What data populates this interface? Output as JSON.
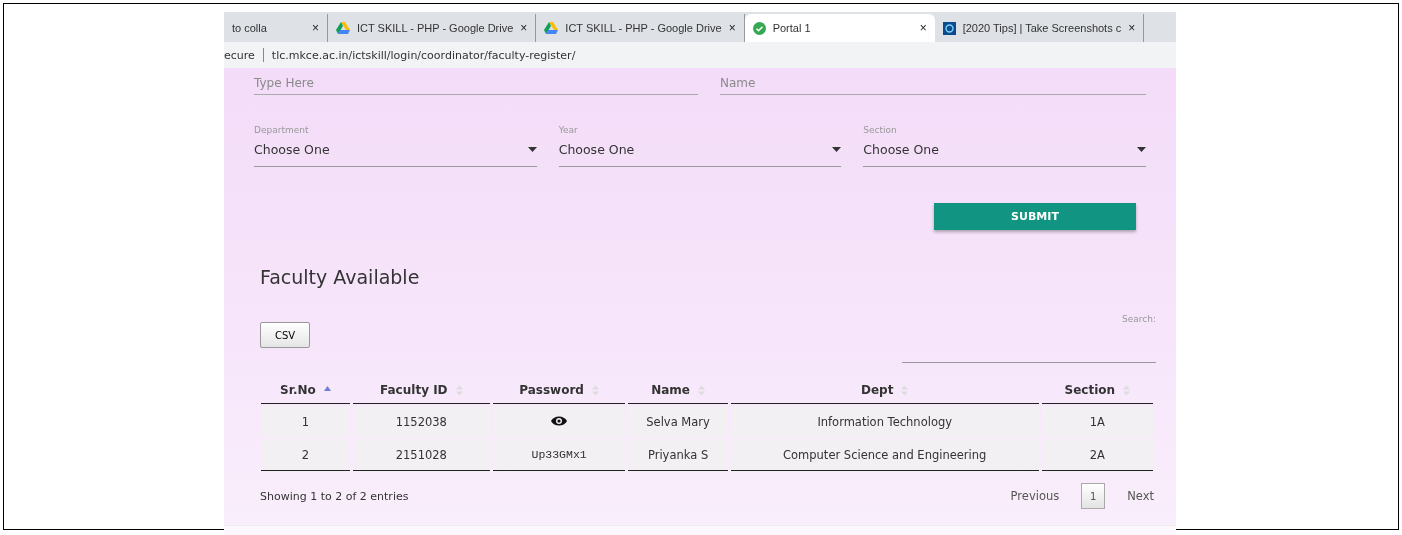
{
  "browser": {
    "tabs": [
      {
        "title": "to colla",
        "kind": "plain",
        "selected": false
      },
      {
        "title": "ICT SKILL - PHP - Google Drive",
        "kind": "drive",
        "selected": false
      },
      {
        "title": "ICT SKILL - PHP - Google Drive",
        "kind": "drive",
        "selected": false
      },
      {
        "title": "Portal 1",
        "kind": "check",
        "selected": true
      },
      {
        "title": "[2020 Tips] | Take Screenshots c",
        "kind": "site",
        "selected": false
      }
    ],
    "close_glyph": "×",
    "security": "ecure",
    "url": "tlc.mkce.ac.in/ictskill/login/coordinator/faculty-register/"
  },
  "form": {
    "top_fields": [
      {
        "placeholder": "Type Here"
      },
      {
        "placeholder": "Name"
      }
    ],
    "selects": [
      {
        "label": "Department",
        "value": "Choose One"
      },
      {
        "label": "Year",
        "value": "Choose One"
      },
      {
        "label": "Section",
        "value": "Choose One"
      }
    ],
    "submit": "SUBMIT"
  },
  "faculty": {
    "title": "Faculty Available",
    "csv": "CSV",
    "search_label": "Search:",
    "columns": [
      {
        "label": "Sr.No",
        "sorted": true
      },
      {
        "label": "Faculty ID",
        "sorted": false
      },
      {
        "label": "Password",
        "sorted": false
      },
      {
        "label": "Name",
        "sorted": false
      },
      {
        "label": "Dept",
        "sorted": false
      },
      {
        "label": "Section",
        "sorted": false
      }
    ],
    "rows": [
      {
        "sr": "1",
        "id": "1152038",
        "password_visible": false,
        "name": "Selva Mary",
        "dept": "Information Technology",
        "section": "1A"
      },
      {
        "sr": "2",
        "id": "2151028",
        "password_visible": true,
        "password": "Up33GMx1",
        "name": "Priyanka S",
        "dept": "Computer Science and Engineering",
        "section": "2A"
      }
    ],
    "info": "Showing 1 to 2 of 2 entries",
    "pagination": [
      {
        "label": "Previous",
        "kind": "link",
        "selected": false
      },
      {
        "label": "1",
        "kind": "page",
        "selected": true
      },
      {
        "label": "Next",
        "kind": "link",
        "selected": false
      }
    ]
  }
}
